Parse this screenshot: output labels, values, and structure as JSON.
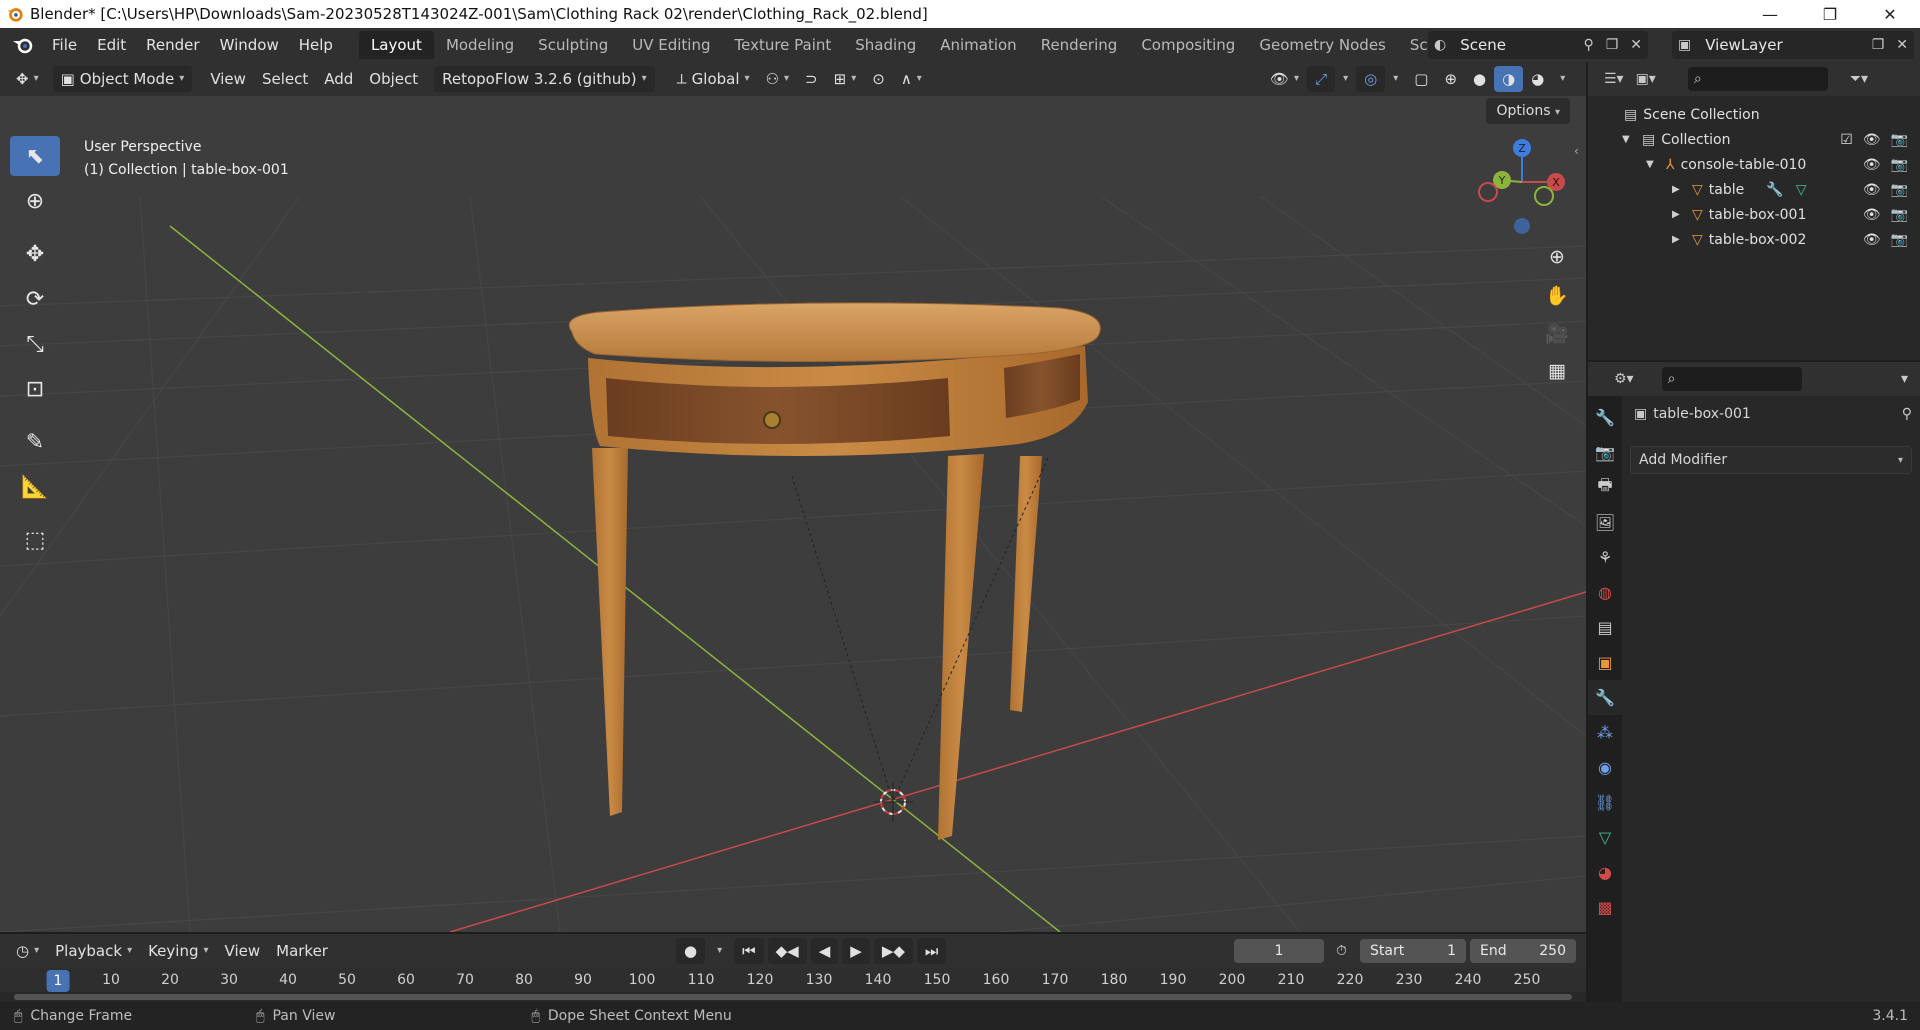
{
  "window": {
    "title": "Blender* [C:\\Users\\HP\\Downloads\\Sam-20230528T143024Z-001\\Sam\\Clothing Rack 02\\render\\Clothing_Rack_02.blend]",
    "minimize": "—",
    "maximize": "❐",
    "close": "✕"
  },
  "menu": [
    "File",
    "Edit",
    "Render",
    "Window",
    "Help"
  ],
  "workspaces": [
    "Layout",
    "Modeling",
    "Sculpting",
    "UV Editing",
    "Texture Paint",
    "Shading",
    "Animation",
    "Rendering",
    "Compositing",
    "Geometry Nodes",
    "Scripting"
  ],
  "active_workspace": "Layout",
  "scene_name": "Scene",
  "view_layer": "ViewLayer",
  "viewport_header": {
    "mode": "Object Mode",
    "view": "View",
    "select": "Select",
    "add": "Add",
    "object": "Object",
    "addon": "RetopoFlow 3.2.6 (github)",
    "transform": "Global",
    "options": "Options"
  },
  "viewport": {
    "perspective": "User Perspective",
    "collection_info": "(1) Collection | table-box-001",
    "gizmo": {
      "x": "X",
      "y": "Y",
      "z": "Z"
    }
  },
  "outliner": {
    "root": "Scene Collection",
    "collection": "Collection",
    "parent": "console-table-010",
    "children": [
      "table",
      "table-box-001",
      "table-box-002"
    ]
  },
  "properties": {
    "object_name": "table-box-001",
    "add_modifier": "Add Modifier"
  },
  "timeline": {
    "playback": "Playback",
    "keying": "Keying",
    "view": "View",
    "marker": "Marker",
    "current_frame": "1",
    "start_label": "Start",
    "start": "1",
    "end_label": "End",
    "end": "250",
    "ticks": [
      "1",
      "10",
      "20",
      "30",
      "40",
      "50",
      "60",
      "70",
      "80",
      "90",
      "100",
      "110",
      "120",
      "130",
      "140",
      "150",
      "160",
      "170",
      "180",
      "190",
      "200",
      "210",
      "220",
      "230",
      "240",
      "250"
    ]
  },
  "status": {
    "left": "Change Frame",
    "middle": "Pan View",
    "right": "Dope Sheet Context Menu",
    "version": "3.4.1"
  },
  "colors": {
    "accent": "#4772b3",
    "x_axis": "#c84a4a",
    "y_axis": "#8cb43c",
    "z_axis": "#3f7ddc"
  }
}
